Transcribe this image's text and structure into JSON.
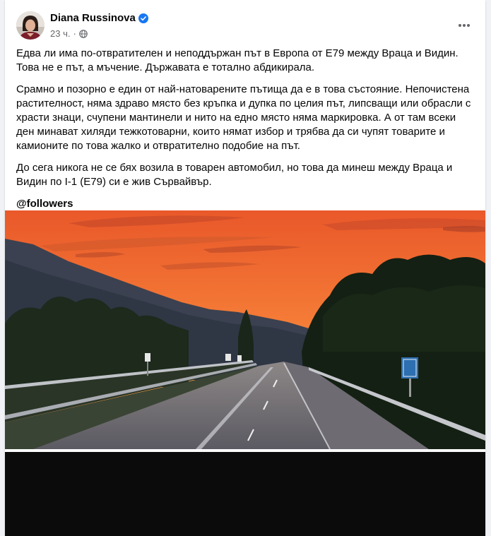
{
  "post": {
    "author": "Diana Russinova",
    "time": "23 ч.",
    "paragraphs": [
      "Едва ли има по-отвратителен и неподдържан път в Европа от Е79 между Враца и Видин. Това не е път, а мъчение. Държавата е тотално абдикирала.",
      "Срамно и позорно е един от най-натоварените пътища да е в това състояние. Непочистена растителност, няма здраво място без кръпка и дупка по целия път, липсващи или обрасли с храсти знаци, счупени мантинели и нито на едно място няма маркировка. А от там всеки ден минават хиляди тежкотоварни, които нямат избор и трябва да си чупят товарите и камионите по това жалко и отвратително подобие на път.",
      "До сега никога не се бях возила в товарен автомобил, но това да минеш между Враца и Видин по I-1 (Е79) си е жив Сървайвър."
    ],
    "mention": "@followers"
  },
  "colors": {
    "verified": "#1877f2",
    "secondary_text": "#65676b",
    "sky_top": "#f26a2c",
    "sky_bottom": "#f7a84a"
  },
  "icons": {
    "verified": "verified-badge-icon",
    "privacy": "globe-icon",
    "more": "more-dots-icon"
  }
}
